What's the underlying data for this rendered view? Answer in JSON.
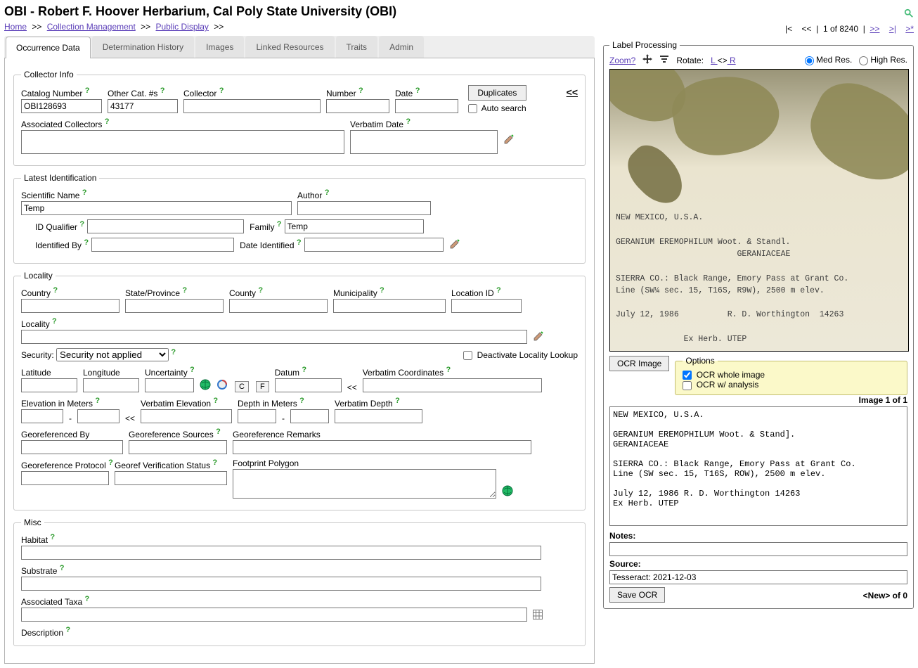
{
  "header": {
    "title": "OBI - Robert F. Hoover Herbarium, Cal Poly State University (OBI)"
  },
  "breadcrumb": {
    "home": "Home",
    "collmgmt": "Collection Management",
    "publicdisp": "Public Display",
    "sep": ">>"
  },
  "pager": {
    "first": "|<",
    "prev": "<<",
    "status": "1 of 8240",
    "next": ">>",
    "last": ">|",
    "newrec": ">*"
  },
  "tabs": {
    "occ": "Occurrence Data",
    "det": "Determination History",
    "img": "Images",
    "linked": "Linked Resources",
    "traits": "Traits",
    "admin": "Admin"
  },
  "collector": {
    "legend": "Collector Info",
    "catalog_lbl": "Catalog Number",
    "catalog_val": "OBI128693",
    "othercat_lbl": "Other Cat. #s",
    "othercat_val": "43177",
    "collector_lbl": "Collector",
    "number_lbl": "Number",
    "date_lbl": "Date",
    "dup_btn": "Duplicates",
    "autosearch": "Auto search",
    "assoc_lbl": "Associated Collectors",
    "verbdate_lbl": "Verbatim Date",
    "collapse": "<<"
  },
  "ident": {
    "legend": "Latest Identification",
    "sciname_lbl": "Scientific Name",
    "sciname_val": "Temp",
    "author_lbl": "Author",
    "idqual_lbl": "ID Qualifier",
    "family_lbl": "Family",
    "family_val": "Temp",
    "identby_lbl": "Identified By",
    "dateident_lbl": "Date Identified"
  },
  "locality": {
    "legend": "Locality",
    "country_lbl": "Country",
    "state_lbl": "State/Province",
    "county_lbl": "County",
    "muni_lbl": "Municipality",
    "locid_lbl": "Location ID",
    "locality_lbl": "Locality",
    "security_lbl": "Security:",
    "security_val": "Security not applied",
    "deact_lbl": "Deactivate Locality Lookup",
    "lat_lbl": "Latitude",
    "lon_lbl": "Longitude",
    "uncert_lbl": "Uncertainty",
    "datum_lbl": "Datum",
    "verbcoord_lbl": "Verbatim Coordinates",
    "c_btn": "C",
    "f_btn": "F",
    "back": "<<",
    "elevm_lbl": "Elevation in Meters",
    "verbelev_lbl": "Verbatim Elevation",
    "depthm_lbl": "Depth in Meters",
    "verbdepth_lbl": "Verbatim Depth",
    "georefby_lbl": "Georeferenced By",
    "georefsrc_lbl": "Georeference Sources",
    "georefrem_lbl": "Georeference Remarks",
    "georefproto_lbl": "Georeference Protocol",
    "georefver_lbl": "Georef Verification Status",
    "footprint_lbl": "Footprint Polygon",
    "dash": "-"
  },
  "misc": {
    "legend": "Misc",
    "habitat_lbl": "Habitat",
    "substrate_lbl": "Substrate",
    "assoctaxa_lbl": "Associated Taxa",
    "desc_lbl": "Description"
  },
  "label": {
    "legend": "Label Processing",
    "zoom": "Zoom?",
    "rotate_lbl": "Rotate:",
    "rotate_l": " L ",
    "rotate_mid": "<>",
    "rotate_r": " R ",
    "medres": "Med Res.",
    "highres": "High Res.",
    "ocr_btn": "OCR Image",
    "opt_legend": "Options",
    "opt_whole": "OCR whole image",
    "opt_analysis": "OCR w/ analysis",
    "imgpager": "Image 1 of 1",
    "ocr_text": "NEW MEXICO, U.S.A.\n\nGERANIUM EREMOPHILUM Woot. & Stand].\nGERANIACEAE\n\nSIERRA CO.: Black Range, Emory Pass at Grant Co.\nLine (SW sec. 15, T16S, ROW), 2500 m elev.\n\nJuly 12, 1986 R. D. Worthington 14263\nEx Herb. UTEP",
    "notes_lbl": "Notes:",
    "source_lbl": "Source:",
    "source_val": "Tesseract: 2021-12-03",
    "save_btn": "Save OCR",
    "newcount": "<New> of 0",
    "specimen_label": "NEW MEXICO, U.S.A.\n\nGERANIUM EREMOPHILUM Woot. & Standl.\n                         GERANIACEAE\n\nSIERRA CO.: Black Range, Emory Pass at Grant Co.\nLine (SW¼ sec. 15, T16S, R9W), 2500 m elev.\n\nJuly 12, 1986          R. D. Worthington  14263\n\n              Ex Herb. UTEP"
  }
}
